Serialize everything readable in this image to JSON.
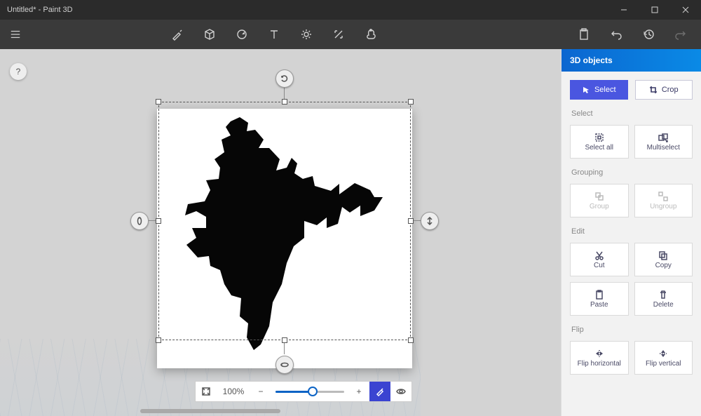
{
  "title": "Untitled* - Paint 3D",
  "panel": {
    "header": "3D objects",
    "tabs": {
      "select": "Select",
      "crop": "Crop"
    },
    "sections": {
      "select": {
        "title": "Select",
        "select_all": "Select all",
        "multiselect": "Multiselect"
      },
      "grouping": {
        "title": "Grouping",
        "group": "Group",
        "ungroup": "Ungroup"
      },
      "edit": {
        "title": "Edit",
        "cut": "Cut",
        "copy": "Copy",
        "paste": "Paste",
        "delete": "Delete"
      },
      "flip": {
        "title": "Flip",
        "h": "Flip horizontal",
        "v": "Flip vertical"
      }
    }
  },
  "zoom": {
    "value": "100%",
    "minus": "−",
    "plus": "+"
  },
  "help": "?"
}
